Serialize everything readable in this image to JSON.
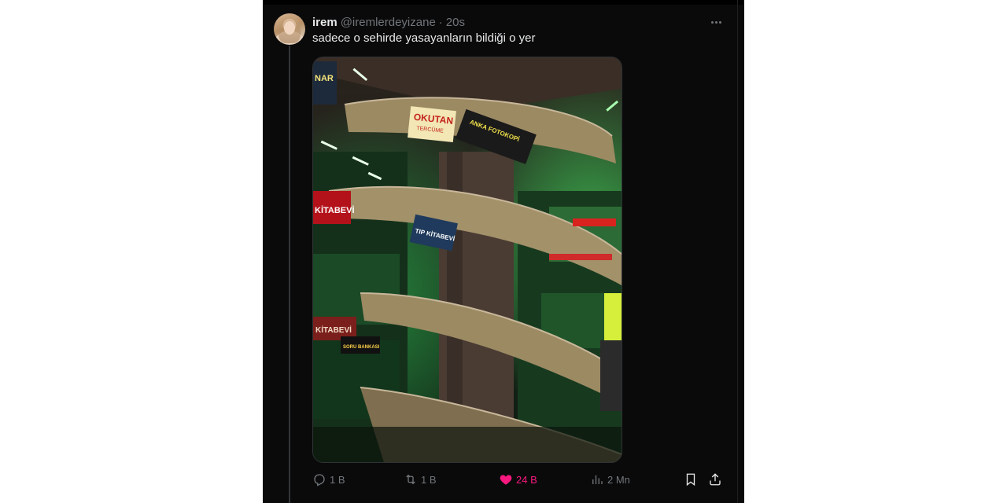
{
  "tweet": {
    "display_name": "irem",
    "handle": "@iremlerdeyizane",
    "separator": "·",
    "time": "20s",
    "text": "sadece o sehirde yasayanların bildiği o yer",
    "media": {
      "signs": {
        "okutan_top": "OKUTAN",
        "okutan_sub": "TERCÜME",
        "anka": "ANKA FOTOKOPİ",
        "kitabevi_left": "KİTABEVİ",
        "tip_kitabevi": "TIP KİTABEVİ",
        "kitabevi_bottom": "KİTABEVİ",
        "nar": "NAR",
        "soru_bankasi": "SORU BANKASI"
      }
    }
  },
  "actions": {
    "reply_count": "1 B",
    "retweet_count": "1 B",
    "like_count": "24 B",
    "views_count": "2 Mn"
  },
  "colors": {
    "background": "#0a0a0a",
    "text_primary": "#e7e9ea",
    "text_secondary": "#71767b",
    "like_pink": "#f91880"
  }
}
